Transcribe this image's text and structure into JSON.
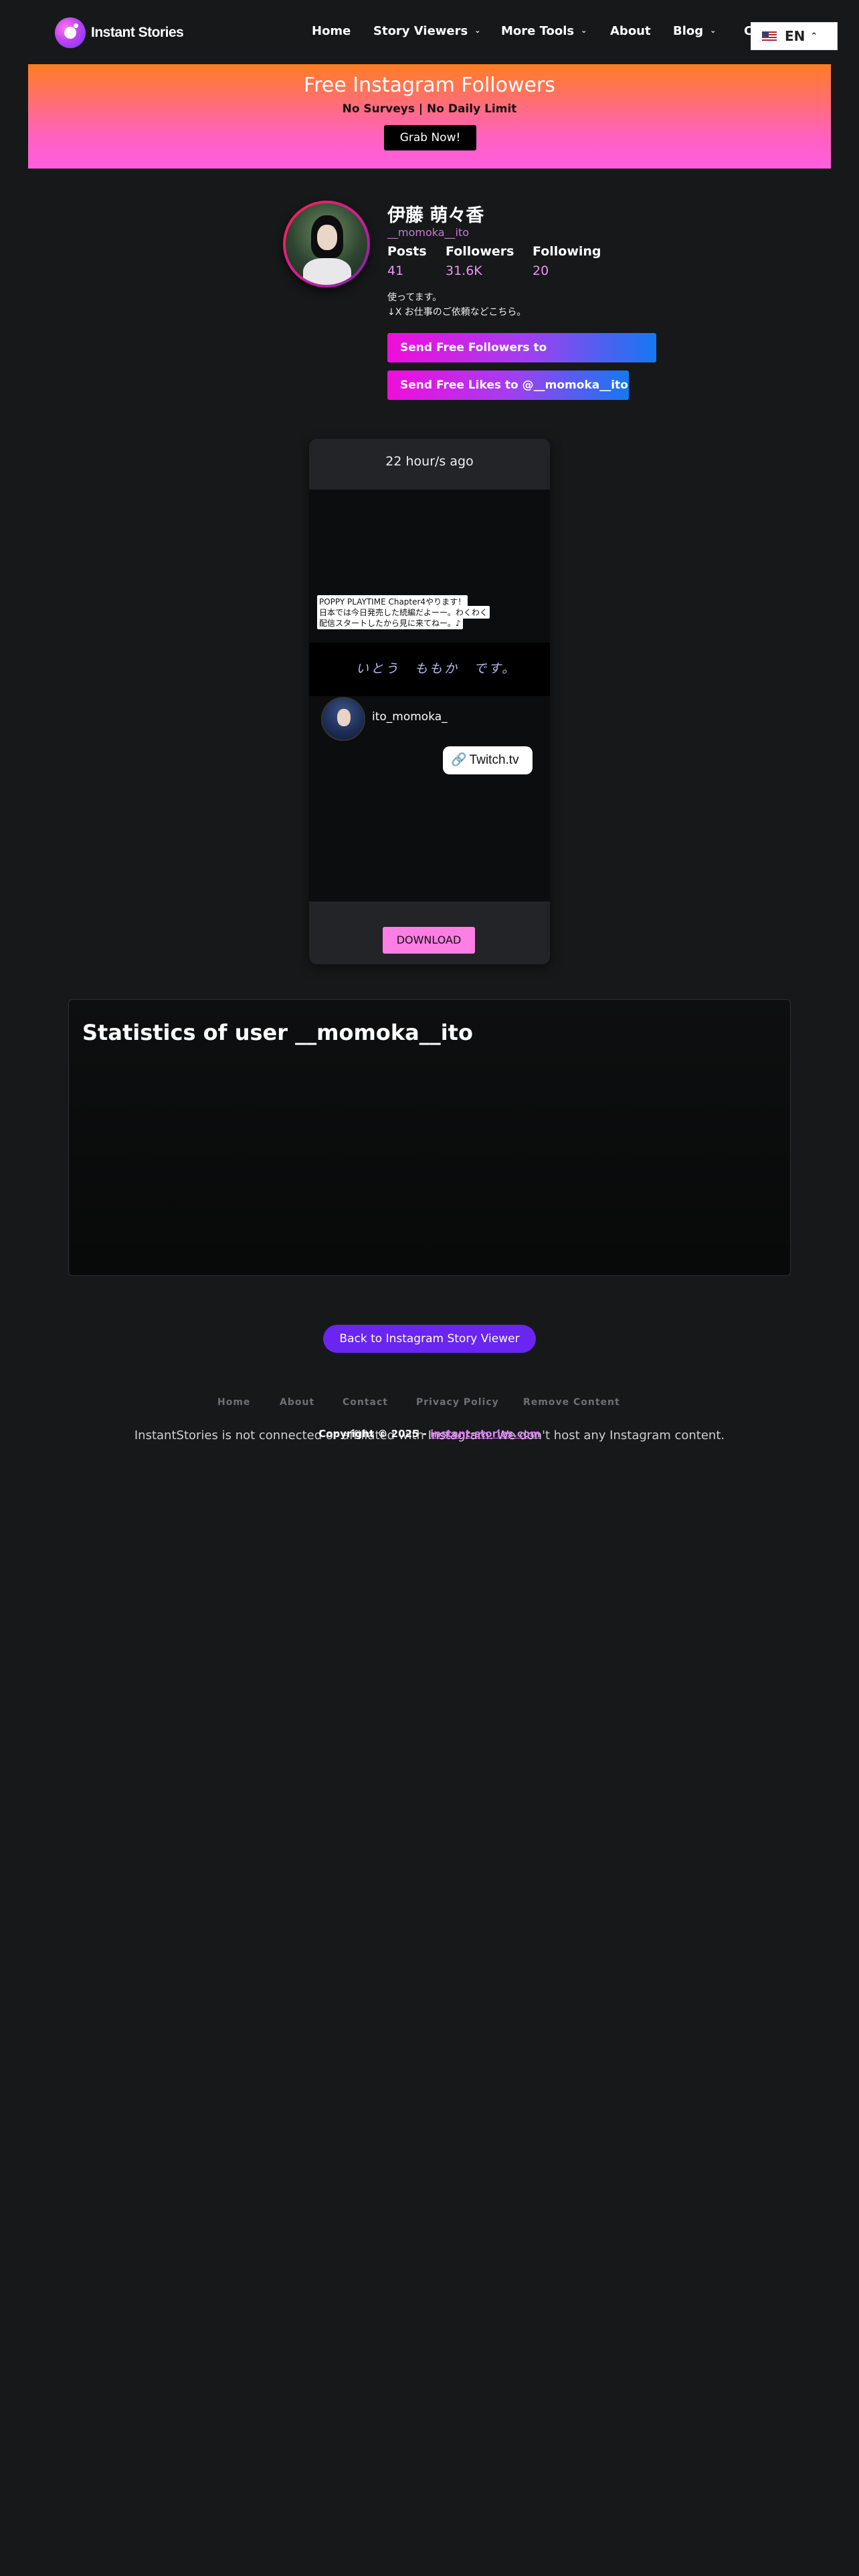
{
  "header": {
    "logo_text": "Instant Stories",
    "nav": {
      "home": "Home",
      "story_viewers": "Story Viewers",
      "more_tools": "More Tools",
      "about": "About",
      "blog": "Blog",
      "contact_partial": "C"
    },
    "language": "EN"
  },
  "promo": {
    "title": "Free Instagram Followers",
    "subtitle": "No Surveys | No Daily Limit",
    "button": "Grab Now!",
    "gradient_top": "#ff7d22",
    "gradient_bottom": "#ff5ee0"
  },
  "profile": {
    "name": "伊藤 萌々香",
    "username": "__momoka__ito",
    "posts_label": "Posts",
    "posts_value": "41",
    "followers_label": "Followers",
    "followers_value": "31.6K",
    "following_label": "Following",
    "following_value": "20",
    "bio_line1": "使ってます。",
    "bio_line2": "↓X お仕事のご依頼などこちら。",
    "followers_button": "Send Free Followers to @__momoka__ito",
    "likes_button": "Send Free Likes to @__momoka__ito"
  },
  "story": {
    "time": "22 hour/s ago",
    "caption_line1": "POPPY PLAYTIME Chapter4やります！",
    "caption_line2": "日本では今日発売した続編だよーー。わくわく",
    "caption_line3": "配信スタートしたから見に来てねー。♪",
    "handwriting": "いとう　ももか　です。",
    "mention_name": "ito_momoka_",
    "link_sticker": "Twitch.tv",
    "download": "DOWNLOAD"
  },
  "statistics": {
    "title": "Statistics of user __momoka__ito"
  },
  "back_button": "Back to Instagram Story Viewer",
  "footer": {
    "links": [
      "Home",
      "About",
      "Contact",
      "Privacy Policy",
      "Remove Content"
    ],
    "disclaimer": "InstantStories is not connected or affiliated with Instagram. We don't host any Instagram content.",
    "copyright_prefix": "Copyright © 2025 - ",
    "copyright_link": "instant-stories.com"
  },
  "colors": {
    "background": "#16181a",
    "accent_pink": "#ee93f5",
    "back_button": "#6a25f0"
  }
}
